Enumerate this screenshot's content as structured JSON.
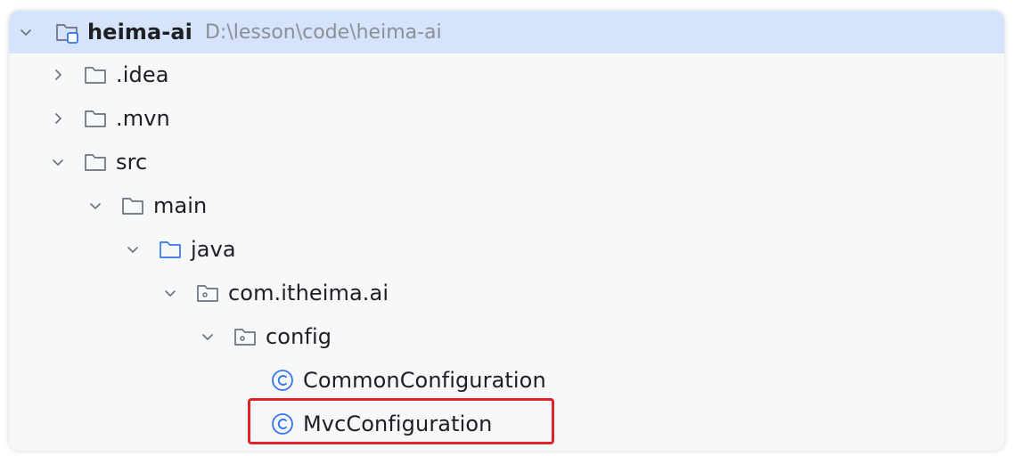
{
  "project_tree": {
    "root": {
      "name": "heima-ai",
      "path": "D:\\lesson\\code\\heima-ai",
      "icon": "module-folder-icon",
      "expanded": true
    },
    "items": [
      {
        "label": ".idea",
        "icon": "folder-icon",
        "chevron": "right"
      },
      {
        "label": ".mvn",
        "icon": "folder-icon",
        "chevron": "right"
      },
      {
        "label": "src",
        "icon": "folder-icon",
        "chevron": "down"
      },
      {
        "label": "main",
        "icon": "folder-icon",
        "chevron": "down"
      },
      {
        "label": "java",
        "icon": "source-root-folder-icon",
        "chevron": "down"
      },
      {
        "label": "com.itheima.ai",
        "icon": "package-icon",
        "chevron": "down"
      },
      {
        "label": "config",
        "icon": "package-icon",
        "chevron": "down"
      },
      {
        "label": "CommonConfiguration",
        "icon": "java-class-icon",
        "chevron": "none"
      },
      {
        "label": "MvcConfiguration",
        "icon": "java-class-icon",
        "chevron": "none",
        "highlighted": true
      }
    ]
  },
  "colors": {
    "selection": "#d6e3fc",
    "highlight_border": "#e1232a",
    "class_icon": "#3574f0",
    "source_root_icon": "#3574f0",
    "folder_icon": "#6c707e"
  }
}
